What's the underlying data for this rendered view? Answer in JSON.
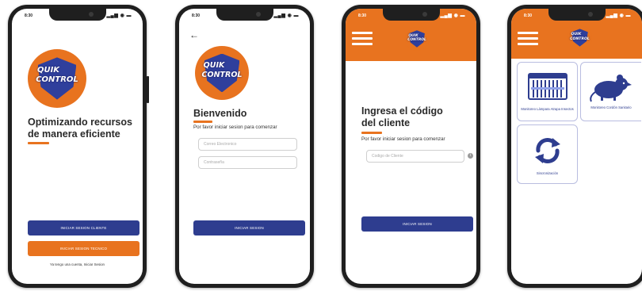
{
  "status_bar": {
    "time": "8:30",
    "icons": "▂▄▆ ◉ ▬"
  },
  "colors": {
    "brand_orange": "#e8731f",
    "brand_blue": "#2e3d8f"
  },
  "logo": {
    "line1": "QUIK",
    "line2": "CONTROL"
  },
  "screen1": {
    "headline_line1": "Optimizando recursos",
    "headline_line2": "de manera eficiente",
    "client_button": "INICIAR SESION CLIENTE",
    "tech_button": "INICIAR SESION TECNICO",
    "account_link": "Ya tengo una cuenta, Iniciar Sesion"
  },
  "screen2": {
    "back_icon": "←",
    "title": "Bienvenido",
    "subtitle": "Por favor iniciar sesion para comenzar",
    "email_placeholder": "Correo Electronico",
    "password_placeholder": "Contraseña",
    "login_button": "INICIAR SESION"
  },
  "screen3": {
    "title_line1": "Ingresa el código",
    "title_line2": "del cliente",
    "subtitle": "Por favor iniciar sesion para comenzar",
    "code_placeholder": "Codigo de Cliente",
    "info_icon": "i",
    "login_button": "INICIAR SESION"
  },
  "screen4": {
    "cards": [
      {
        "icon": "lamp-trap-icon",
        "label": "Monitoreo Lámpara Atrapa Insectos"
      },
      {
        "icon": "rat-icon",
        "label": "Monitoreo Cordón Sanitario"
      },
      {
        "icon": "sync-icon",
        "label": "Sincronización"
      }
    ]
  }
}
